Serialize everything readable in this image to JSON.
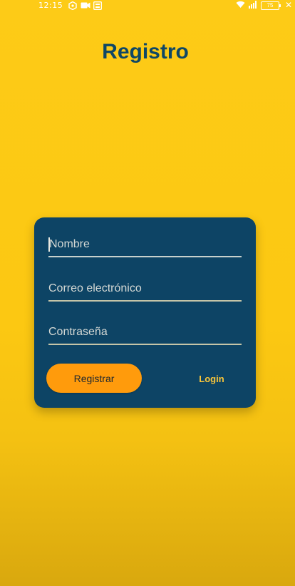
{
  "status_bar": {
    "time": "12:15",
    "battery": "75"
  },
  "page": {
    "title": "Registro"
  },
  "form": {
    "name_placeholder": "Nombre",
    "email_placeholder": "Correo electrónico",
    "password_placeholder": "Contraseña",
    "register_label": "Registrar",
    "login_label": "Login"
  },
  "colors": {
    "background": "#fcc812",
    "card": "#0d4465",
    "title": "#0f4765",
    "register_button": "#ff9b0c",
    "login_text": "#f8c53a"
  }
}
